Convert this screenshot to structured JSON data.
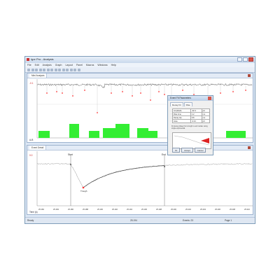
{
  "window": {
    "title": "Igor Pro - Analysis",
    "menus": [
      "File",
      "Edit",
      "Analysis",
      "Graph",
      "Layout",
      "Panel",
      "Macros",
      "Windows",
      "Help"
    ]
  },
  "top_pane": {
    "tab_label": "Mini Analysis",
    "y_tick_upper": "-0.1",
    "bottom_label": "A-B"
  },
  "bottom_pane": {
    "tab_label": "Event Detail",
    "start_label": "Start",
    "end_label": "End",
    "trough_label": "Trough",
    "y_tick_upper": "0.0",
    "bottom_label": "Time (s)",
    "x_ticks": [
      "25.182",
      "25.184",
      "25.186",
      "25.188",
      "25.190",
      "25.192",
      "25.194",
      "25.196",
      "25.198",
      "25.200",
      "25.202",
      "25.204",
      "25.206",
      "25.208",
      "25.210"
    ]
  },
  "dialog": {
    "title": "Event Fit Parameters",
    "tabs": [
      "Decay Fit",
      "Rise"
    ],
    "rows": [
      [
        "Amplitude",
        "-32.4",
        "pA"
      ],
      [
        "Rise time",
        "1.2",
        "ms"
      ],
      [
        "Decay tau",
        "6.8",
        "ms"
      ],
      [
        "Area",
        "-0.21",
        "pC"
      ]
    ],
    "note": "Fit decay phase from trough to end marker using single exponential.",
    "buttons": [
      "Fit",
      "Accept",
      "Cancel"
    ]
  },
  "statusbar": {
    "left": "Ready",
    "mid": "25.194",
    "right1": "Events: 23",
    "right2": "Page 1"
  },
  "colors": {
    "trace": "#7a7a7a",
    "events": "#ff3333",
    "bars": "#33ee33"
  }
}
